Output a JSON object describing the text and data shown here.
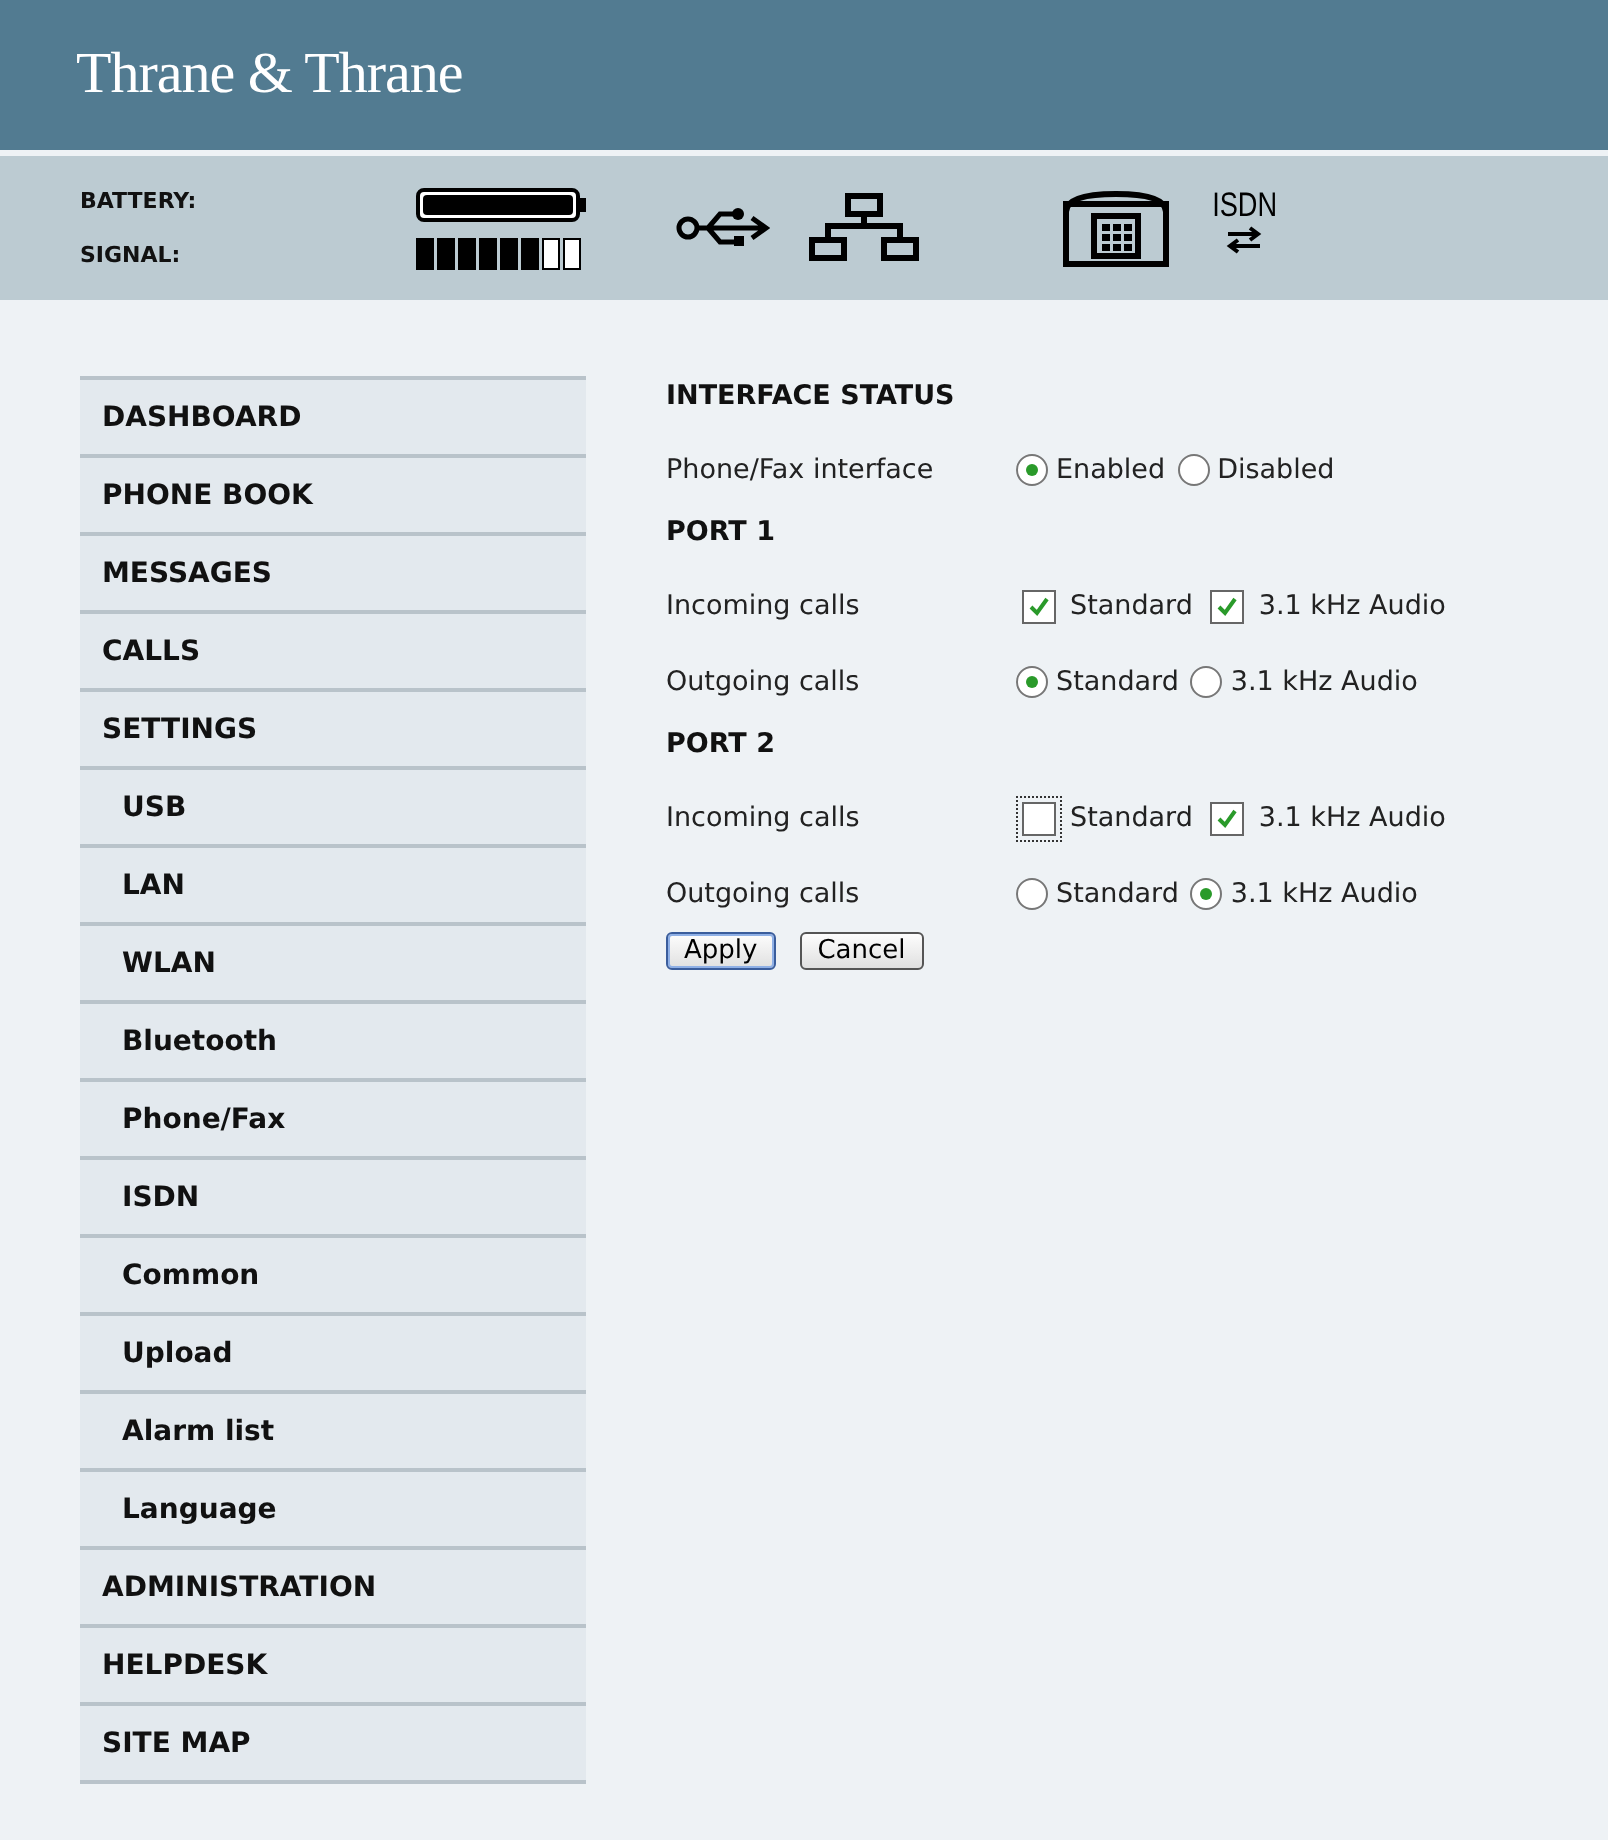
{
  "header": {
    "logo": "Thrane & Thrane"
  },
  "status": {
    "battery_label": "BATTERY:",
    "signal_label": "SIGNAL:",
    "isdn_label": "ISDN"
  },
  "menu": [
    {
      "label": "DASHBOARD"
    },
    {
      "label": "PHONE BOOK"
    },
    {
      "label": "MESSAGES"
    },
    {
      "label": "CALLS"
    },
    {
      "label": "SETTINGS",
      "children": [
        {
          "label": "USB"
        },
        {
          "label": "LAN"
        },
        {
          "label": "WLAN"
        },
        {
          "label": "Bluetooth"
        },
        {
          "label": "Phone/Fax"
        },
        {
          "label": "ISDN"
        },
        {
          "label": "Common"
        },
        {
          "label": "Upload"
        },
        {
          "label": "Alarm list"
        },
        {
          "label": "Language"
        }
      ]
    },
    {
      "label": "ADMINISTRATION"
    },
    {
      "label": "HELPDESK"
    },
    {
      "label": "SITE MAP"
    }
  ],
  "sections": [
    {
      "title": "INTERFACE STATUS",
      "rows": [
        {
          "label": "Phone/Fax interface",
          "kind": "radio",
          "options": [
            {
              "label": "Enabled",
              "selected": true
            },
            {
              "label": "Disabled",
              "selected": false
            }
          ]
        }
      ]
    },
    {
      "title": "PORT 1",
      "rows": [
        {
          "label": "Incoming calls",
          "kind": "checkbox",
          "options": [
            {
              "label": "Standard",
              "checked": true,
              "focused": false
            },
            {
              "label": "3.1 kHz Audio",
              "checked": true,
              "focused": false
            }
          ]
        },
        {
          "label": "Outgoing calls",
          "kind": "radio",
          "options": [
            {
              "label": "Standard",
              "selected": true
            },
            {
              "label": "3.1 kHz Audio",
              "selected": false
            }
          ]
        }
      ]
    },
    {
      "title": "PORT 2",
      "rows": [
        {
          "label": "Incoming calls",
          "kind": "checkbox",
          "options": [
            {
              "label": "Standard",
              "checked": false,
              "focused": true
            },
            {
              "label": "3.1 kHz Audio",
              "checked": true,
              "focused": false
            }
          ]
        },
        {
          "label": "Outgoing calls",
          "kind": "radio",
          "options": [
            {
              "label": "Standard",
              "selected": false
            },
            {
              "label": "3.1 kHz Audio",
              "selected": true
            }
          ]
        }
      ]
    }
  ],
  "buttons": [
    {
      "label": "Apply",
      "default": true
    },
    {
      "label": "Cancel",
      "default": false
    }
  ]
}
